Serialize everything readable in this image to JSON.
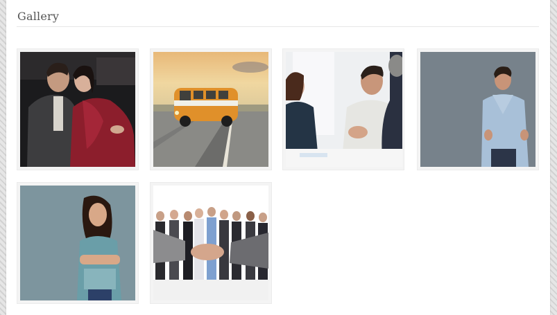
{
  "gallery": {
    "title": "Gallery",
    "images": [
      {
        "name": "couple-in-car-photo"
      },
      {
        "name": "vintage-bus-on-road-photo"
      },
      {
        "name": "business-handshake-meeting-photo"
      },
      {
        "name": "man-blue-shirt-portrait-photo"
      },
      {
        "name": "woman-smiling-portrait-photo"
      },
      {
        "name": "business-team-handshake-photo"
      }
    ]
  },
  "colors": {
    "panel_background": "#ffffff",
    "heading_text": "#555555",
    "page_background": "#dcdcdc"
  }
}
